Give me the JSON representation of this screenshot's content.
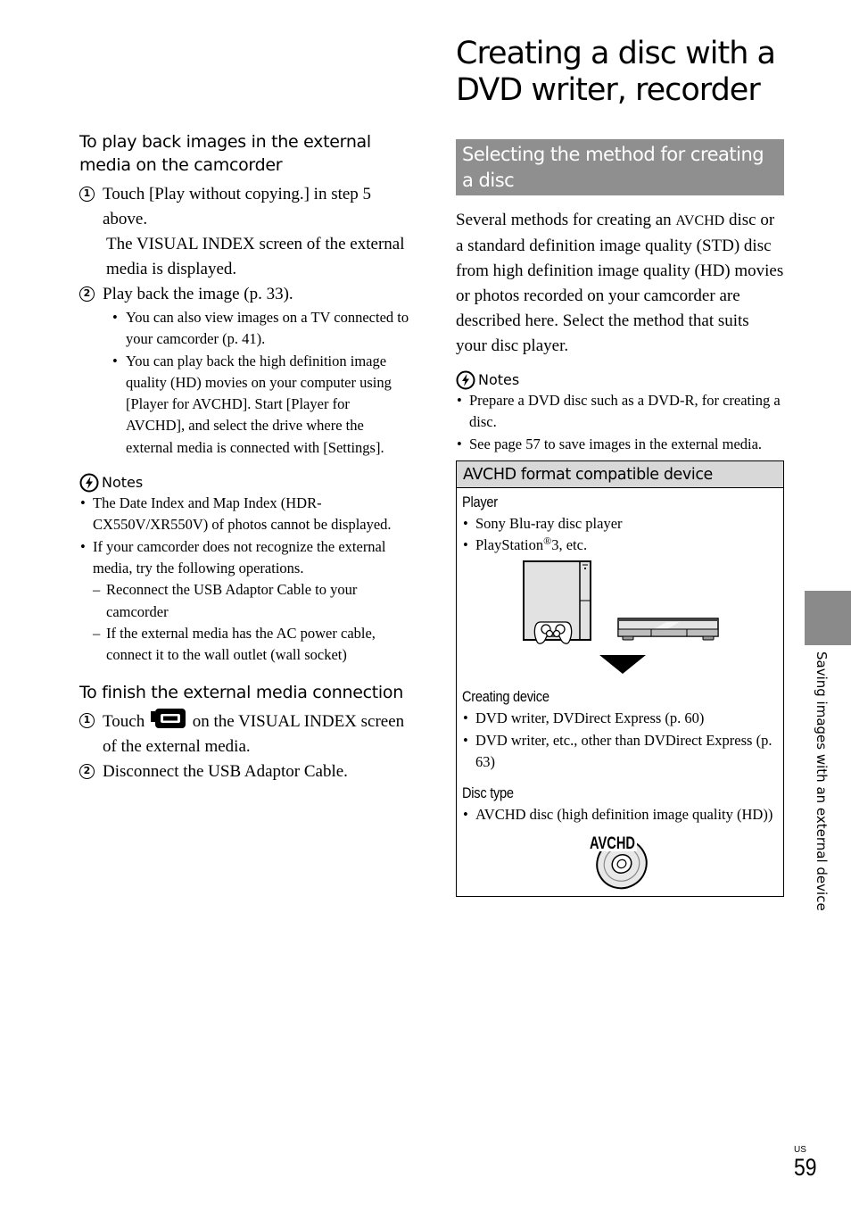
{
  "left": {
    "playback_heading": "To play back images in the external media on the camcorder",
    "playback_steps": [
      {
        "num": "1",
        "text": "Touch [Play without copying.] in step 5 above.",
        "result": "The VISUAL INDEX screen of the external media is displayed."
      },
      {
        "num": "2",
        "text": "Play back the image (p. 33).",
        "bullets": [
          "You can also view images on a TV connected to your camcorder (p. 41).",
          "You can play back the high definition image quality (HD) movies on your computer using [Player for AVCHD]. Start [Player for AVCHD], and select the drive where the external media is connected with [Settings]."
        ]
      }
    ],
    "notes": {
      "icon": "notes-caution-icon",
      "label": "Notes",
      "items": [
        "The Date Index and Map Index (HDR-CX550V/XR550V) of photos cannot be displayed.",
        "If your camcorder does not recognize the external media, try the following operations."
      ],
      "sub_items": [
        "Reconnect the USB Adaptor Cable to your camcorder",
        "If the external media has the AC power cable, connect it to the wall outlet (wall socket)"
      ]
    },
    "finish_heading": "To finish the external media connection",
    "finish_steps": [
      {
        "num": "1",
        "before_icon": "Touch",
        "icon": "camcorder-mode-icon",
        "after_icon": "on the VISUAL INDEX screen of the external media."
      },
      {
        "num": "2",
        "text": "Disconnect the USB Adaptor Cable."
      }
    ]
  },
  "right": {
    "title_line1": "Creating a disc with a",
    "title_line2": "DVD writer, recorder",
    "section_heading": "Selecting the method for creating a disc",
    "intro_pre": "Several methods for creating an",
    "intro_avchd": "AVCHD",
    "intro_post": "disc or a standard definition image quality (STD) disc from high definition image quality (HD) movies or photos recorded on your camcorder are described here. Select the method that suits your disc player.",
    "notes": {
      "label": "Notes",
      "items": [
        "Prepare a DVD disc such as a DVD-R, for creating a disc.",
        "See page 57 to save images in the external media."
      ]
    },
    "box": {
      "title": "AVCHD format compatible device",
      "player_label": "Player",
      "players": [
        "Sony Blu-ray disc player",
        "PlayStation"
      ],
      "ps_registered": "®",
      "ps_suffix": "3, etc.",
      "creating_label": "Creating device",
      "creating_items": [
        "DVD writer, DVDirect Express (p. 60)",
        "DVD writer, etc., other than DVDirect Express (p. 63)"
      ],
      "disc_label": "Disc type",
      "disc_items": [
        "AVCHD disc (high definition image quality (HD))"
      ],
      "disc_logo_text": "AVCHD"
    }
  },
  "side_tab": {
    "text": "Saving images with an external device",
    "color": "#8a8a8a"
  },
  "footer": {
    "region": "US",
    "page_number": "59"
  },
  "colors": {
    "section_bar": "#8f8f8f",
    "box_header": "#d8d8d8"
  }
}
